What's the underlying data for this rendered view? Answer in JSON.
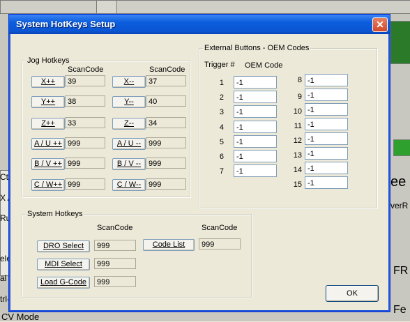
{
  "background": {
    "left_labels": [
      "Ctrl",
      "X A",
      "Ru",
      "elet",
      "al S",
      "trl-"
    ],
    "bottom_label": "CV Mode",
    "right_labels": [
      "ee",
      "verR",
      "FR",
      "Fe"
    ]
  },
  "dialog": {
    "title": "System HotKeys Setup",
    "close_glyph": "✕",
    "ok_label": "OK"
  },
  "jog": {
    "legend": "Jog Hotkeys",
    "scancode_header": "ScanCode",
    "rows": [
      {
        "left_label": "X++",
        "left_value": "39",
        "right_label": "X--",
        "right_value": "37"
      },
      {
        "left_label": "Y++",
        "left_value": "38",
        "right_label": "Y--",
        "right_value": "40"
      },
      {
        "left_label": "Z++",
        "left_value": "33",
        "right_label": "Z--",
        "right_value": "34"
      },
      {
        "left_label": "A / U ++",
        "left_value": "999",
        "right_label": "A / U --",
        "right_value": "999"
      },
      {
        "left_label": "B / V ++",
        "left_value": "999",
        "right_label": "B / V --",
        "right_value": "999"
      },
      {
        "left_label": "C / W++",
        "left_value": "999",
        "right_label": "C / W--",
        "right_value": "999"
      }
    ]
  },
  "system": {
    "legend": "System Hotkeys",
    "scancode_header": "ScanCode",
    "dro_label": "DRO Select",
    "dro_value": "999",
    "mdi_label": "MDI Select",
    "mdi_value": "999",
    "load_label": "Load G-Code",
    "load_value": "999",
    "codelist_label": "Code List",
    "codelist_value": "999"
  },
  "external": {
    "legend": "External Buttons - OEM Codes",
    "trigger_header": "Trigger  #",
    "oem_header": "OEM Code",
    "left_triggers": [
      {
        "num": "1",
        "value": "-1"
      },
      {
        "num": "2",
        "value": "-1"
      },
      {
        "num": "3",
        "value": "-1"
      },
      {
        "num": "4",
        "value": "-1"
      },
      {
        "num": "5",
        "value": "-1"
      },
      {
        "num": "6",
        "value": "-1"
      },
      {
        "num": "7",
        "value": "-1"
      }
    ],
    "right_triggers": [
      {
        "num": "8",
        "value": "-1"
      },
      {
        "num": "9",
        "value": "-1"
      },
      {
        "num": "10",
        "value": "-1"
      },
      {
        "num": "11",
        "value": "-1"
      },
      {
        "num": "12",
        "value": "-1"
      },
      {
        "num": "13",
        "value": "-1"
      },
      {
        "num": "14",
        "value": "-1"
      },
      {
        "num": "15",
        "value": "-1"
      }
    ]
  }
}
